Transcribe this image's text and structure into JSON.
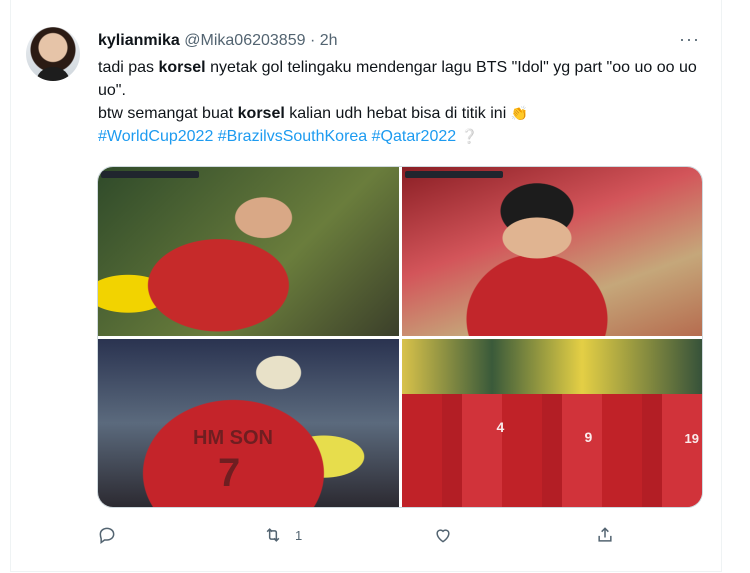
{
  "tweet": {
    "display_name": "kylianmika",
    "handle": "@Mika06203859",
    "separator": " · ",
    "time": "2h",
    "more_label": "···",
    "line1_before": "tadi pas ",
    "line1_bold": "korsel",
    "line1_after": " nyetak gol telingaku mendengar lagu BTS \"Idol\" yg part \"oo uo oo uo uo\".",
    "line2_before": "btw semangat buat ",
    "line2_bold": "korsel",
    "line2_after": " kalian udh hebat bisa di titik ini",
    "line2_emoji": "👏",
    "hashtags": "#WorldCup2022 #BrazilvsSouthKorea #Qatar2022",
    "hashtag_emoji": "❔"
  },
  "photos": {
    "photo3_jersey_text": "HM SON",
    "photo3_number": "7",
    "photo4_number_a": "4",
    "photo4_number_b": "9",
    "photo4_number_c": "19"
  },
  "actions": {
    "reply_count": "",
    "retweet_count": "1",
    "like_count": ""
  }
}
